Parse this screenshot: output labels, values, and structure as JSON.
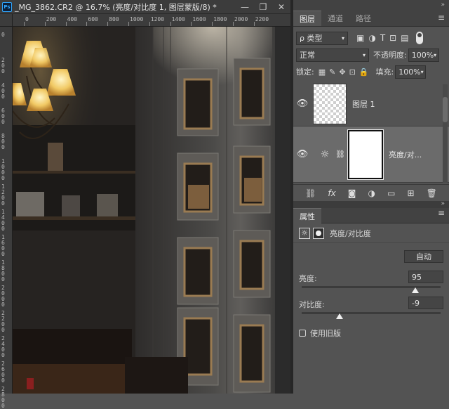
{
  "document": {
    "app_badge": "Ps",
    "title": "_MG_3862.CR2 @ 16.7% (亮度/对比度 1, 图层蒙版/8) *",
    "window_buttons": [
      "—",
      "❐",
      "✕"
    ],
    "ruler_top_labels": [
      "0",
      "200",
      "400",
      "600",
      "800",
      "1000",
      "1200",
      "1400",
      "1600",
      "1800",
      "2000",
      "2200"
    ],
    "ruler_left_labels": [
      "0",
      "2 0 0",
      "4 0 0",
      "6 0 0",
      "8 0 0",
      "1 0 0 0",
      "1 2 0 0",
      "1 4 0 0",
      "1 6 0 0",
      "1 8 0 0",
      "2 0 0 0",
      "2 2 0 0",
      "2 4 0 0",
      "2 6 0 0",
      "2 8 0 0"
    ]
  },
  "layers_panel": {
    "tabs": [
      "图层",
      "通道",
      "路径"
    ],
    "active_tab": "图层",
    "collapse_glyph": "»",
    "menu_glyph": "≡",
    "filter": {
      "label": "ρ 类型",
      "icons": [
        "▣",
        "◑",
        "T",
        "⊡",
        "▤"
      ]
    },
    "blend_mode": "正常",
    "opacity_label": "不透明度:",
    "opacity_value": "100%",
    "lock_label": "锁定:",
    "lock_icons": [
      "▦",
      "✎",
      "✥",
      "⊡",
      "🔒"
    ],
    "fill_label": "填充:",
    "fill_value": "100%",
    "layers": [
      {
        "name": "图层 1",
        "type": "pixel",
        "visible": true,
        "selected": false
      },
      {
        "name": "亮度/对...",
        "type": "adjustment",
        "visible": true,
        "selected": true
      }
    ],
    "footer_icons": [
      "⛓",
      "fx",
      "◙",
      "◑",
      "▭",
      "⊞",
      "🗑"
    ]
  },
  "properties_panel": {
    "tab": "属性",
    "collapse_glyph": "»",
    "menu_glyph": "≡",
    "type_label": "亮度/对比度",
    "auto_button": "自动",
    "brightness_label": "亮度:",
    "brightness_value": "95",
    "brightness_min": -150,
    "brightness_max": 150,
    "contrast_label": "对比度:",
    "contrast_value": "-9",
    "contrast_min": -50,
    "contrast_max": 100,
    "legacy_label": "使用旧版",
    "legacy_checked": false
  }
}
